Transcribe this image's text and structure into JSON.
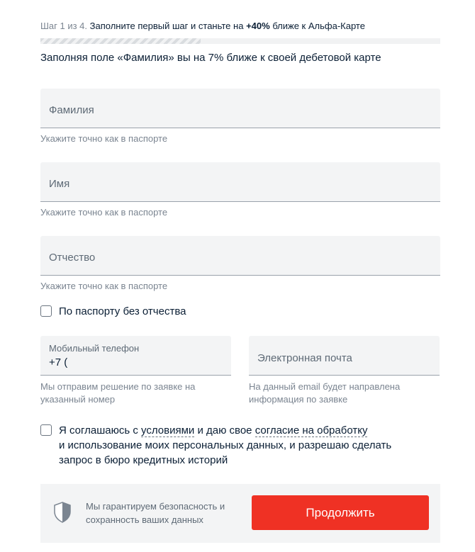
{
  "progress": {
    "step_text": "Шаг 1 из 4.",
    "message_before": "Заполните первый шаг и станьте на",
    "highlight": "+40%",
    "message_after": "ближе к Альфа-Карте",
    "completed_fraction": 0.4
  },
  "subtitle": "Заполняя поле «Фамилия» вы на 7% ближе к своей дебетовой карте",
  "fields": {
    "last_name": {
      "placeholder": "Фамилия",
      "hint": "Укажите точно как в паспорте"
    },
    "first_name": {
      "placeholder": "Имя",
      "hint": "Укажите точно как в паспорте"
    },
    "middle_name": {
      "placeholder": "Отчество",
      "hint": "Укажите точно как в паспорте"
    },
    "phone": {
      "label": "Мобильный телефон",
      "value": "+7 (",
      "hint_line1": "Мы отправим решение по заявке на",
      "hint_line2": "указанный номер"
    },
    "email": {
      "placeholder": "Электронная почта",
      "hint_line1": "На данный email будет направлена",
      "hint_line2": "информация по заявке"
    }
  },
  "no_middle_name": {
    "label": "По паспорту без отчества",
    "checked": false
  },
  "consent": {
    "prefix": "Я соглашаюсь с",
    "link_terms": "условиями",
    "middle": "и даю свое",
    "link_processing": "согласие на обработку",
    "line2": "и использование моих персональных данных, и разрешаю сделать",
    "line3": "запрос в бюро кредитных историй",
    "checked": false
  },
  "footer": {
    "icon": "shield-icon",
    "guarantee_line1": "Мы гарантируем безопасность и",
    "guarantee_line2": "сохранность ваших данных",
    "continue_label": "Продолжить"
  },
  "colors": {
    "accent": "#ef3124",
    "field_bg": "#f3f4f5",
    "text": "#0b1f35",
    "muted": "#7b8591"
  }
}
